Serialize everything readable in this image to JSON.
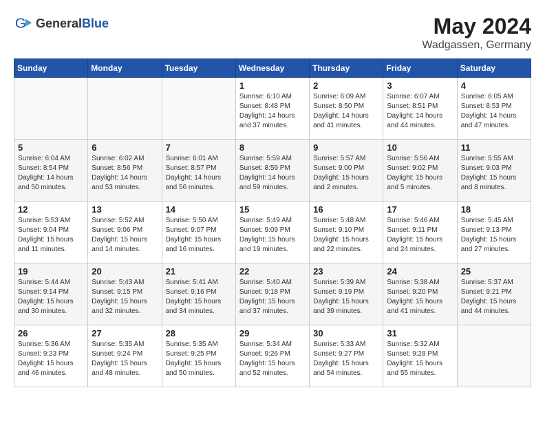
{
  "header": {
    "logo": {
      "text_general": "General",
      "text_blue": "Blue",
      "icon": "▶"
    },
    "title": "May 2024",
    "location": "Wadgassen, Germany"
  },
  "days_of_week": [
    "Sunday",
    "Monday",
    "Tuesday",
    "Wednesday",
    "Thursday",
    "Friday",
    "Saturday"
  ],
  "weeks": [
    [
      {
        "day": "",
        "sunrise": "",
        "sunset": "",
        "daylight": ""
      },
      {
        "day": "",
        "sunrise": "",
        "sunset": "",
        "daylight": ""
      },
      {
        "day": "",
        "sunrise": "",
        "sunset": "",
        "daylight": ""
      },
      {
        "day": "1",
        "sunrise": "Sunrise: 6:10 AM",
        "sunset": "Sunset: 8:48 PM",
        "daylight": "Daylight: 14 hours and 37 minutes."
      },
      {
        "day": "2",
        "sunrise": "Sunrise: 6:09 AM",
        "sunset": "Sunset: 8:50 PM",
        "daylight": "Daylight: 14 hours and 41 minutes."
      },
      {
        "day": "3",
        "sunrise": "Sunrise: 6:07 AM",
        "sunset": "Sunset: 8:51 PM",
        "daylight": "Daylight: 14 hours and 44 minutes."
      },
      {
        "day": "4",
        "sunrise": "Sunrise: 6:05 AM",
        "sunset": "Sunset: 8:53 PM",
        "daylight": "Daylight: 14 hours and 47 minutes."
      }
    ],
    [
      {
        "day": "5",
        "sunrise": "Sunrise: 6:04 AM",
        "sunset": "Sunset: 8:54 PM",
        "daylight": "Daylight: 14 hours and 50 minutes."
      },
      {
        "day": "6",
        "sunrise": "Sunrise: 6:02 AM",
        "sunset": "Sunset: 8:56 PM",
        "daylight": "Daylight: 14 hours and 53 minutes."
      },
      {
        "day": "7",
        "sunrise": "Sunrise: 6:01 AM",
        "sunset": "Sunset: 8:57 PM",
        "daylight": "Daylight: 14 hours and 56 minutes."
      },
      {
        "day": "8",
        "sunrise": "Sunrise: 5:59 AM",
        "sunset": "Sunset: 8:59 PM",
        "daylight": "Daylight: 14 hours and 59 minutes."
      },
      {
        "day": "9",
        "sunrise": "Sunrise: 5:57 AM",
        "sunset": "Sunset: 9:00 PM",
        "daylight": "Daylight: 15 hours and 2 minutes."
      },
      {
        "day": "10",
        "sunrise": "Sunrise: 5:56 AM",
        "sunset": "Sunset: 9:02 PM",
        "daylight": "Daylight: 15 hours and 5 minutes."
      },
      {
        "day": "11",
        "sunrise": "Sunrise: 5:55 AM",
        "sunset": "Sunset: 9:03 PM",
        "daylight": "Daylight: 15 hours and 8 minutes."
      }
    ],
    [
      {
        "day": "12",
        "sunrise": "Sunrise: 5:53 AM",
        "sunset": "Sunset: 9:04 PM",
        "daylight": "Daylight: 15 hours and 11 minutes."
      },
      {
        "day": "13",
        "sunrise": "Sunrise: 5:52 AM",
        "sunset": "Sunset: 9:06 PM",
        "daylight": "Daylight: 15 hours and 14 minutes."
      },
      {
        "day": "14",
        "sunrise": "Sunrise: 5:50 AM",
        "sunset": "Sunset: 9:07 PM",
        "daylight": "Daylight: 15 hours and 16 minutes."
      },
      {
        "day": "15",
        "sunrise": "Sunrise: 5:49 AM",
        "sunset": "Sunset: 9:09 PM",
        "daylight": "Daylight: 15 hours and 19 minutes."
      },
      {
        "day": "16",
        "sunrise": "Sunrise: 5:48 AM",
        "sunset": "Sunset: 9:10 PM",
        "daylight": "Daylight: 15 hours and 22 minutes."
      },
      {
        "day": "17",
        "sunrise": "Sunrise: 5:46 AM",
        "sunset": "Sunset: 9:11 PM",
        "daylight": "Daylight: 15 hours and 24 minutes."
      },
      {
        "day": "18",
        "sunrise": "Sunrise: 5:45 AM",
        "sunset": "Sunset: 9:13 PM",
        "daylight": "Daylight: 15 hours and 27 minutes."
      }
    ],
    [
      {
        "day": "19",
        "sunrise": "Sunrise: 5:44 AM",
        "sunset": "Sunset: 9:14 PM",
        "daylight": "Daylight: 15 hours and 30 minutes."
      },
      {
        "day": "20",
        "sunrise": "Sunrise: 5:43 AM",
        "sunset": "Sunset: 9:15 PM",
        "daylight": "Daylight: 15 hours and 32 minutes."
      },
      {
        "day": "21",
        "sunrise": "Sunrise: 5:41 AM",
        "sunset": "Sunset: 9:16 PM",
        "daylight": "Daylight: 15 hours and 34 minutes."
      },
      {
        "day": "22",
        "sunrise": "Sunrise: 5:40 AM",
        "sunset": "Sunset: 9:18 PM",
        "daylight": "Daylight: 15 hours and 37 minutes."
      },
      {
        "day": "23",
        "sunrise": "Sunrise: 5:39 AM",
        "sunset": "Sunset: 9:19 PM",
        "daylight": "Daylight: 15 hours and 39 minutes."
      },
      {
        "day": "24",
        "sunrise": "Sunrise: 5:38 AM",
        "sunset": "Sunset: 9:20 PM",
        "daylight": "Daylight: 15 hours and 41 minutes."
      },
      {
        "day": "25",
        "sunrise": "Sunrise: 5:37 AM",
        "sunset": "Sunset: 9:21 PM",
        "daylight": "Daylight: 15 hours and 44 minutes."
      }
    ],
    [
      {
        "day": "26",
        "sunrise": "Sunrise: 5:36 AM",
        "sunset": "Sunset: 9:23 PM",
        "daylight": "Daylight: 15 hours and 46 minutes."
      },
      {
        "day": "27",
        "sunrise": "Sunrise: 5:35 AM",
        "sunset": "Sunset: 9:24 PM",
        "daylight": "Daylight: 15 hours and 48 minutes."
      },
      {
        "day": "28",
        "sunrise": "Sunrise: 5:35 AM",
        "sunset": "Sunset: 9:25 PM",
        "daylight": "Daylight: 15 hours and 50 minutes."
      },
      {
        "day": "29",
        "sunrise": "Sunrise: 5:34 AM",
        "sunset": "Sunset: 9:26 PM",
        "daylight": "Daylight: 15 hours and 52 minutes."
      },
      {
        "day": "30",
        "sunrise": "Sunrise: 5:33 AM",
        "sunset": "Sunset: 9:27 PM",
        "daylight": "Daylight: 15 hours and 54 minutes."
      },
      {
        "day": "31",
        "sunrise": "Sunrise: 5:32 AM",
        "sunset": "Sunset: 9:28 PM",
        "daylight": "Daylight: 15 hours and 55 minutes."
      },
      {
        "day": "",
        "sunrise": "",
        "sunset": "",
        "daylight": ""
      }
    ]
  ]
}
